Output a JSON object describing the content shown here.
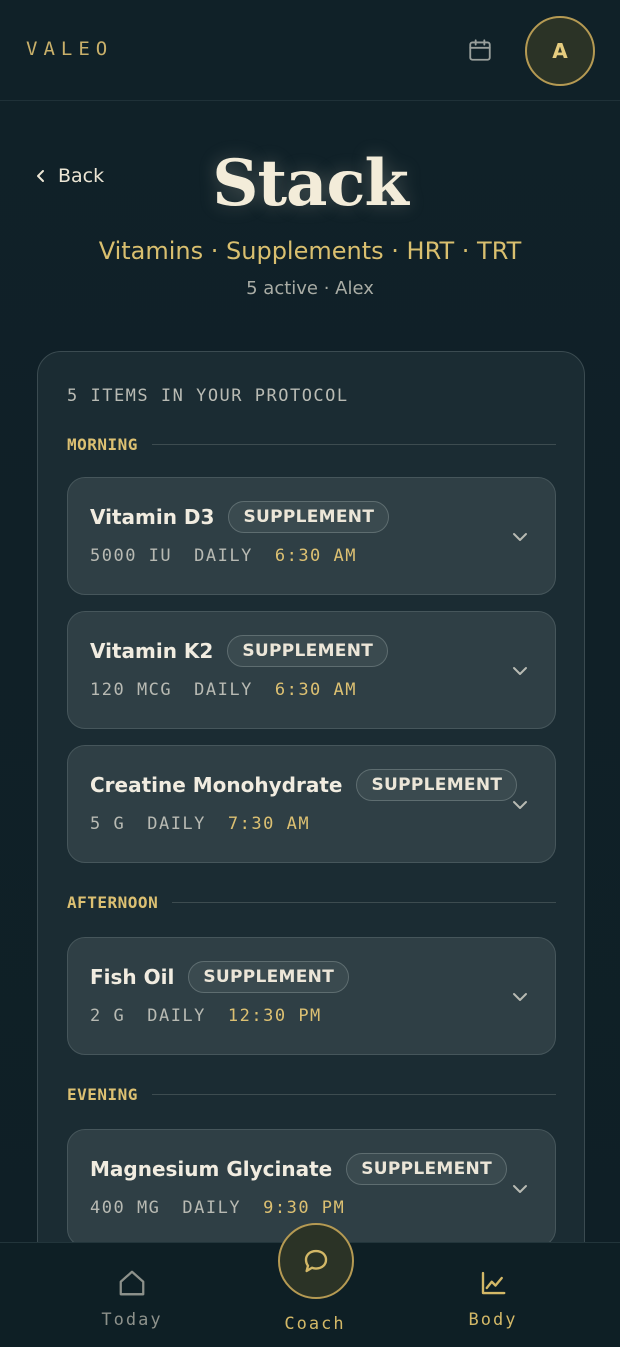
{
  "header": {
    "brand": "VALEO",
    "avatar_initial": "A"
  },
  "page": {
    "back_label": "Back",
    "title": "Stack",
    "subtitle": "Vitamins · Supplements · HRT · TRT",
    "meta": "5 active · Alex"
  },
  "protocol": {
    "count_label": "5 ITEMS IN YOUR PROTOCOL",
    "sections": [
      {
        "label": "MORNING",
        "items": [
          {
            "name": "Vitamin D3",
            "badge": "SUPPLEMENT",
            "dose": "5000 IU",
            "frequency": "DAILY",
            "time": "6:30 AM"
          },
          {
            "name": "Vitamin K2",
            "badge": "SUPPLEMENT",
            "dose": "120 MCG",
            "frequency": "DAILY",
            "time": "6:30 AM"
          },
          {
            "name": "Creatine Monohydrate",
            "badge": "SUPPLEMENT",
            "dose": "5 G",
            "frequency": "DAILY",
            "time": "7:30 AM"
          }
        ]
      },
      {
        "label": "AFTERNOON",
        "items": [
          {
            "name": "Fish Oil",
            "badge": "SUPPLEMENT",
            "dose": "2 G",
            "frequency": "DAILY",
            "time": "12:30 PM"
          }
        ]
      },
      {
        "label": "EVENING",
        "items": [
          {
            "name": "Magnesium Glycinate",
            "badge": "SUPPLEMENT",
            "dose": "400 MG",
            "frequency": "DAILY",
            "time": "9:30 PM"
          }
        ]
      }
    ]
  },
  "nav": {
    "today": "Today",
    "coach": "Coach",
    "body": "Body"
  },
  "colors": {
    "background": "#0f1f25",
    "accent_gold": "#dcc072",
    "card": "#2f3f45"
  },
  "icons": {
    "calendar": "calendar-icon",
    "back": "chevron-left-icon",
    "expand": "chevron-down-icon",
    "today": "home-icon",
    "coach": "chat-bubble-icon",
    "body": "chart-icon"
  }
}
